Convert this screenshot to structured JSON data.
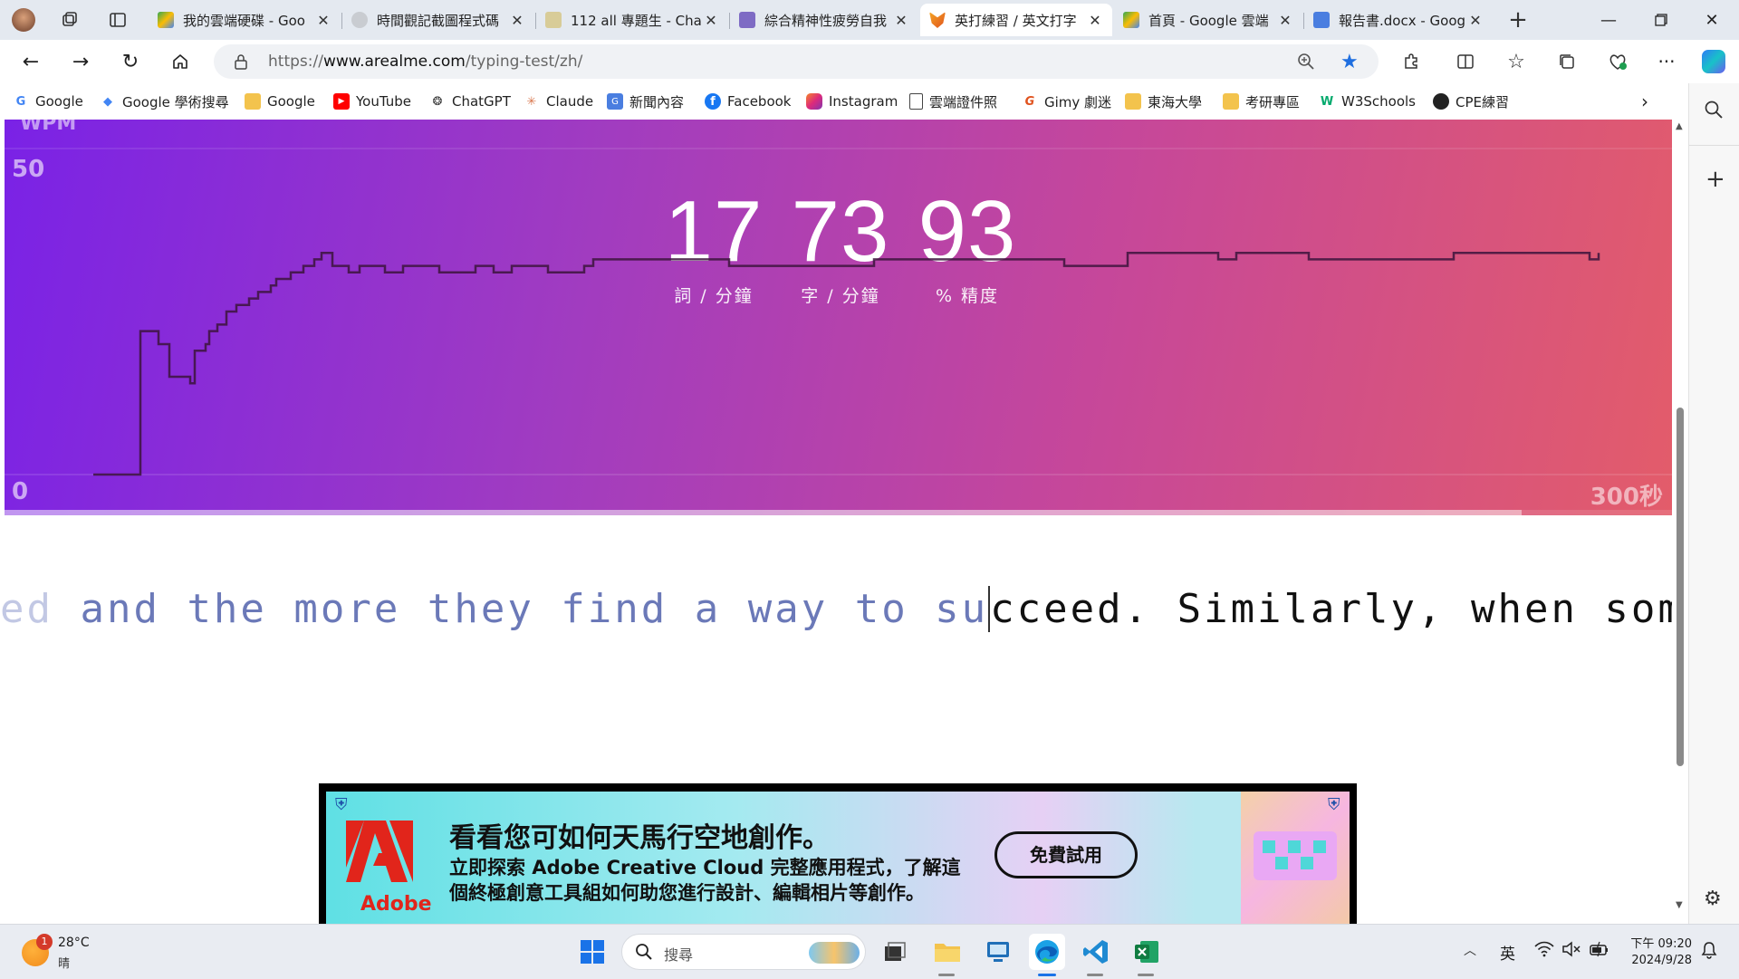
{
  "browser": {
    "tabs": [
      {
        "title": "我的雲端硬碟 - Goo",
        "favicon_color": "#34a853"
      },
      {
        "title": "時間觀記截圖程式碼",
        "favicon_color": "#9aa0a6"
      },
      {
        "title": "112 all 專題生 - Chat",
        "favicon_color": "#d4c58a"
      },
      {
        "title": "綜合精神性疲勞自我",
        "favicon_color": "#7e6bc4"
      },
      {
        "title": "英打練習 / 英文打字",
        "favicon_color": "#f08a24",
        "active": true
      },
      {
        "title": "首頁 - Google 雲端",
        "favicon_color": "#34a853"
      },
      {
        "title": "報告書.docx - Googl",
        "favicon_color": "#4a7ee0"
      }
    ],
    "url_prefix": "https://",
    "url_host": "www.arealme.com",
    "url_path": "/typing-test/zh/",
    "bookmarks": [
      {
        "label": "Google",
        "icon": "google-icon"
      },
      {
        "label": "Google 學術搜尋",
        "icon": "scholar-icon"
      },
      {
        "label": "Google",
        "icon": "folder-icon"
      },
      {
        "label": "YouTube",
        "icon": "youtube-icon"
      },
      {
        "label": "ChatGPT",
        "icon": "chatgpt-icon"
      },
      {
        "label": "Claude",
        "icon": "claude-icon"
      },
      {
        "label": "新聞內容",
        "icon": "news-icon"
      },
      {
        "label": "Facebook",
        "icon": "facebook-icon"
      },
      {
        "label": "Instagram",
        "icon": "instagram-icon"
      },
      {
        "label": "雲端證件照",
        "icon": "page-icon"
      },
      {
        "label": "Gimy 劇迷",
        "icon": "gimy-icon"
      },
      {
        "label": "東海大學",
        "icon": "folder-icon"
      },
      {
        "label": "考研專區",
        "icon": "folder-icon"
      },
      {
        "label": "W3Schools",
        "icon": "w3schools-icon"
      },
      {
        "label": "CPE練習",
        "icon": "github-icon"
      }
    ]
  },
  "typing_test": {
    "chart_label": "WPM",
    "y_max_label": "50",
    "y_min_label": "0",
    "x_end_label": "300秒",
    "progress": 0.91,
    "stats": [
      {
        "value": "17",
        "unit": "詞 / 分鐘"
      },
      {
        "value": "73",
        "unit": "字 / 分鐘"
      },
      {
        "value": "93",
        "unit": "% 精度"
      }
    ],
    "text_fade_left": "ed ",
    "text_typed": "and the more they find a way to su",
    "text_remaining": "cceed. Similarly, when someone is ",
    "text_fade_right": "f",
    "wpm_curve": [
      0,
      0,
      0,
      0,
      0,
      0,
      0,
      0,
      0,
      0,
      0,
      0,
      0,
      0,
      0,
      0,
      0,
      0,
      0,
      0,
      0,
      0,
      0,
      0,
      0,
      0,
      0,
      0,
      0,
      0,
      0,
      0,
      0,
      0,
      0,
      0,
      0,
      0,
      0,
      0,
      0,
      0,
      0,
      0,
      0,
      0,
      0,
      0,
      0,
      0,
      0,
      0,
      0,
      0,
      0,
      0,
      0,
      0,
      0,
      0,
      0,
      0,
      0,
      0,
      0,
      0,
      0,
      0,
      0,
      0,
      0,
      0,
      0,
      0,
      0,
      0,
      0,
      0,
      0,
      0,
      0,
      0,
      0,
      0,
      0,
      0,
      0,
      0,
      0,
      0,
      0,
      0,
      0,
      0,
      0,
      0,
      0,
      0,
      0,
      0
    ]
  },
  "ad": {
    "brand": "Adobe",
    "headline": "看看您可如何天馬行空地創作。",
    "sub1": "立即探索 Adobe Creative Cloud 完整應用程式，了解這",
    "sub2": "個終極創意工具組如何助您進行設計、編輯相片等創作。",
    "cta": "免費試用"
  },
  "taskbar": {
    "weather_temp": "28°C",
    "weather_desc": "晴",
    "weather_badge": "1",
    "search_placeholder": "搜尋",
    "ime": "英",
    "time": "下午 09:20",
    "date": "2024/9/28"
  }
}
